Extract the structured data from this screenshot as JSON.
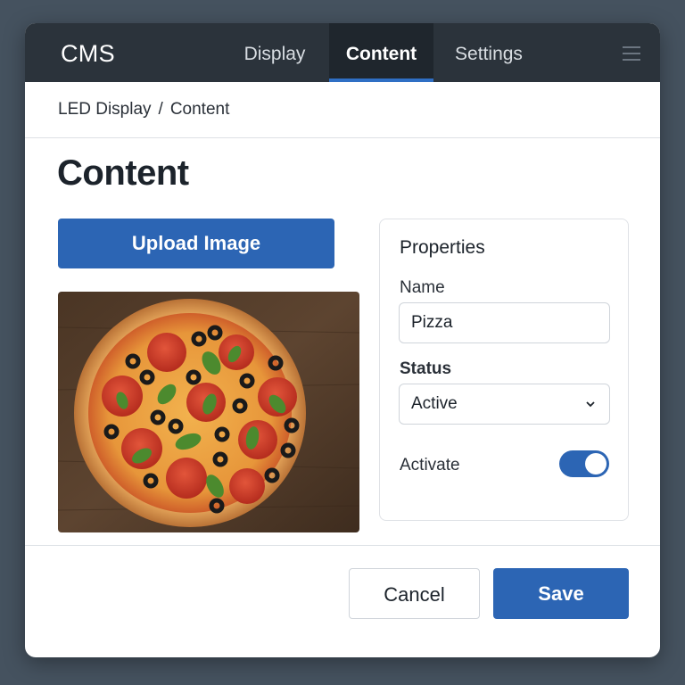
{
  "app": {
    "title": "CMS"
  },
  "nav": {
    "tabs": [
      {
        "label": "Display"
      },
      {
        "label": "Content"
      },
      {
        "label": "Settings"
      }
    ],
    "active_tab": "Content",
    "menu_icon": "hamburger-menu-icon"
  },
  "breadcrumb": {
    "items": [
      "LED Display",
      "Content"
    ],
    "separator": "/"
  },
  "page": {
    "title": "Content"
  },
  "upload": {
    "label": "Upload Image"
  },
  "preview": {
    "subject": "Pizza"
  },
  "properties": {
    "title": "Properties",
    "name_label": "Name",
    "name_value": "Pizza",
    "status_label": "Status",
    "status_value": "Active",
    "activate_label": "Activate",
    "activate_on": true
  },
  "actions": {
    "cancel_label": "Cancel",
    "save_label": "Save"
  },
  "colors": {
    "accent": "#2c65b4",
    "topbar": "#2b333b",
    "background": "#45525f"
  }
}
